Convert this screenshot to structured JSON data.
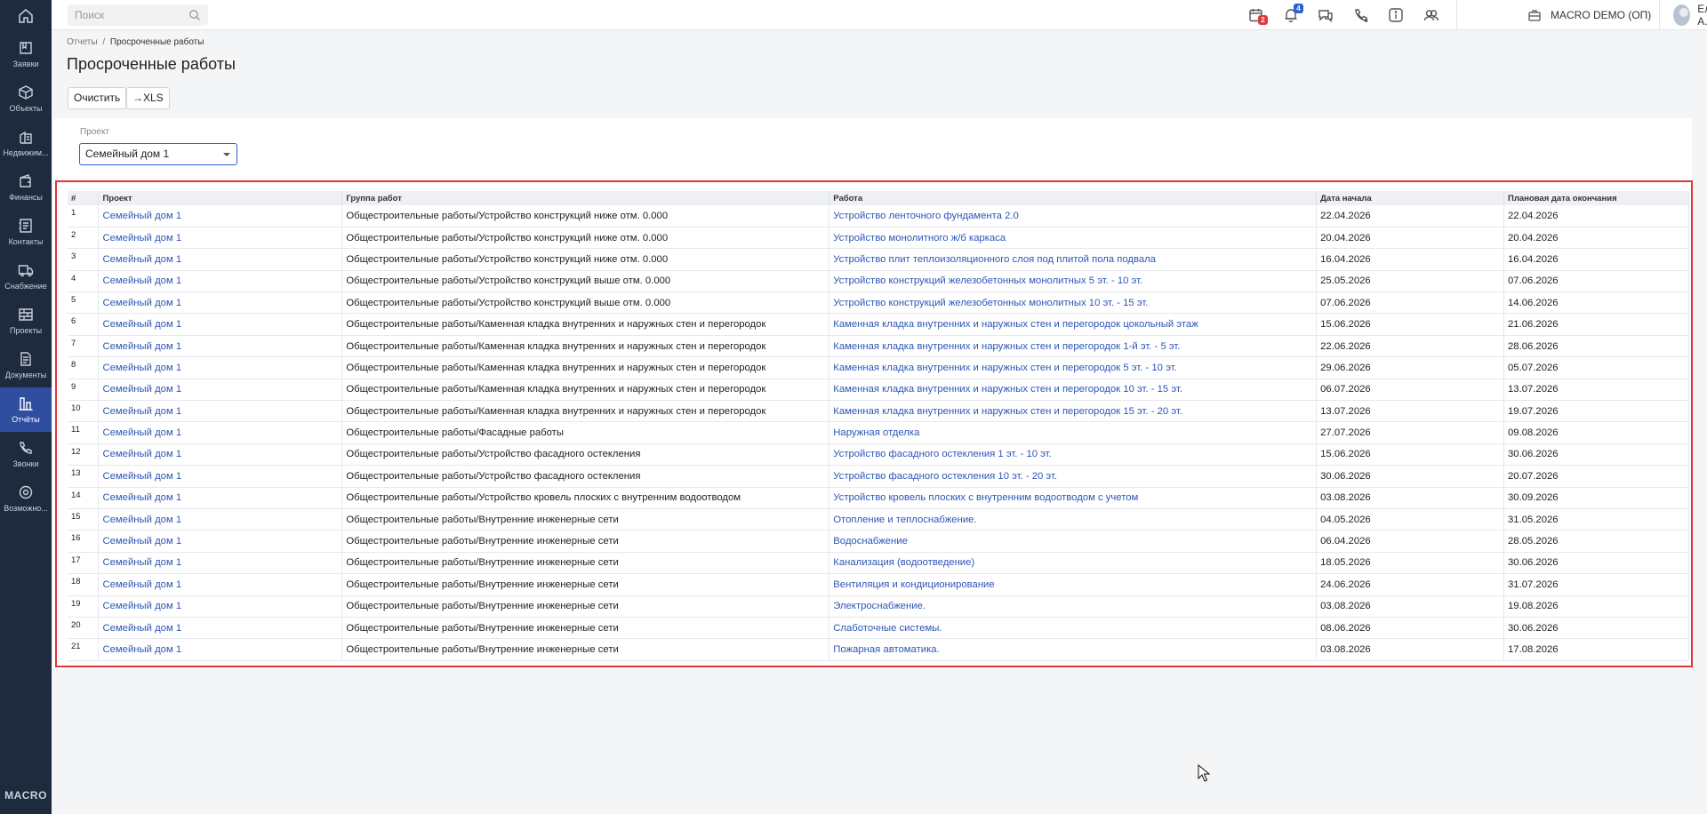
{
  "sidebar": {
    "logo": "MACRO",
    "items": [
      {
        "label": "Заявки",
        "icon": "requests-icon"
      },
      {
        "label": "Объекты",
        "icon": "box-icon"
      },
      {
        "label": "Недвижим...",
        "icon": "building-icon"
      },
      {
        "label": "Финансы",
        "icon": "wallet-icon"
      },
      {
        "label": "Контакты",
        "icon": "contacts-icon"
      },
      {
        "label": "Снабжение",
        "icon": "truck-icon"
      },
      {
        "label": "Проекты",
        "icon": "projects-icon"
      },
      {
        "label": "Документы",
        "icon": "document-icon"
      },
      {
        "label": "Отчёты",
        "icon": "reports-icon"
      },
      {
        "label": "Звонки",
        "icon": "phone-icon"
      },
      {
        "label": "Возможно...",
        "icon": "gear-icon"
      }
    ]
  },
  "topbar": {
    "search_placeholder": "Поиск",
    "calendar_badge": "2",
    "notifications_badge": "4",
    "company": "MACRO DEMO (ОП)",
    "user": "Елена А."
  },
  "breadcrumb": {
    "parent": "Отчеты",
    "separator": "/",
    "current": "Просроченные работы"
  },
  "page_title": "Просроченные работы",
  "toolbar": {
    "clear_label": "Очистить",
    "xls_label": "→XLS"
  },
  "filter": {
    "label": "Проект",
    "value": "Семейный дом 1"
  },
  "table": {
    "columns": [
      "#",
      "Проект",
      "Группа работ",
      "Работа",
      "Дата начала",
      "Плановая дата окончания"
    ],
    "rows": [
      [
        "1",
        "Семейный дом 1",
        "Общестроительные работы/Устройство конструкций ниже отм. 0.000",
        "Устройство ленточного фундамента 2.0",
        "22.04.2026",
        "22.04.2026"
      ],
      [
        "2",
        "Семейный дом 1",
        "Общестроительные работы/Устройство конструкций ниже отм. 0.000",
        "Устройство монолитного ж/б каркаса",
        "20.04.2026",
        "20.04.2026"
      ],
      [
        "3",
        "Семейный дом 1",
        "Общестроительные работы/Устройство конструкций ниже отм. 0.000",
        "Устройство плит теплоизоляционного слоя под плитой пола подвала",
        "16.04.2026",
        "16.04.2026"
      ],
      [
        "4",
        "Семейный дом 1",
        "Общестроительные работы/Устройство конструкций выше отм. 0.000",
        "Устройство конструкций железобетонных монолитных 5 эт. - 10 эт.",
        "25.05.2026",
        "07.06.2026"
      ],
      [
        "5",
        "Семейный дом 1",
        "Общестроительные работы/Устройство конструкций выше отм. 0.000",
        "Устройство конструкций железобетонных монолитных 10 эт. - 15 эт.",
        "07.06.2026",
        "14.06.2026"
      ],
      [
        "6",
        "Семейный дом 1",
        "Общестроительные работы/Каменная кладка внутренних и наружных стен и перегородок",
        "Каменная кладка внутренних и наружных стен и перегородок цокольный этаж",
        "15.06.2026",
        "21.06.2026"
      ],
      [
        "7",
        "Семейный дом 1",
        "Общестроительные работы/Каменная кладка внутренних и наружных стен и перегородок",
        "Каменная кладка внутренних и наружных стен и перегородок 1-й эт. - 5 эт.",
        "22.06.2026",
        "28.06.2026"
      ],
      [
        "8",
        "Семейный дом 1",
        "Общестроительные работы/Каменная кладка внутренних и наружных стен и перегородок",
        "Каменная кладка внутренних и наружных стен и перегородок  5 эт. - 10 эт.",
        "29.06.2026",
        "05.07.2026"
      ],
      [
        "9",
        "Семейный дом 1",
        "Общестроительные работы/Каменная кладка внутренних и наружных стен и перегородок",
        "Каменная кладка внутренних и наружных стен и перегородок  10 эт. - 15 эт.",
        "06.07.2026",
        "13.07.2026"
      ],
      [
        "10",
        "Семейный дом 1",
        "Общестроительные работы/Каменная кладка внутренних и наружных стен и перегородок",
        "Каменная кладка внутренних и наружных стен и перегородок  15 эт. - 20 эт.",
        "13.07.2026",
        "19.07.2026"
      ],
      [
        "11",
        "Семейный дом 1",
        "Общестроительные работы/Фасадные работы",
        "Наружная отделка",
        "27.07.2026",
        "09.08.2026"
      ],
      [
        "12",
        "Семейный дом 1",
        "Общестроительные работы/Устройство фасадного остекления",
        "Устройство фасадного остекления 1 эт. - 10 эт.",
        "15.06.2026",
        "30.06.2026"
      ],
      [
        "13",
        "Семейный дом 1",
        "Общестроительные работы/Устройство фасадного остекления",
        "Устройство фасадного остекления 10 эт. - 20 эт.",
        "30.06.2026",
        "20.07.2026"
      ],
      [
        "14",
        "Семейный дом 1",
        "Общестроительные работы/Устройство кровель плоских с внутренним водоотводом",
        "Устройство кровель плоских с внутренним водоотводом с учетом",
        "03.08.2026",
        "30.09.2026"
      ],
      [
        "15",
        "Семейный дом 1",
        "Общестроительные работы/Внутренние инженерные сети",
        "Отопление и теплоснабжение.",
        "04.05.2026",
        "31.05.2026"
      ],
      [
        "16",
        "Семейный дом 1",
        "Общестроительные работы/Внутренние инженерные сети",
        "Водоснабжение",
        "06.04.2026",
        "28.05.2026"
      ],
      [
        "17",
        "Семейный дом 1",
        "Общестроительные работы/Внутренние инженерные сети",
        "Канализация (водоотведение)",
        "18.05.2026",
        "30.06.2026"
      ],
      [
        "18",
        "Семейный дом 1",
        "Общестроительные работы/Внутренние инженерные сети",
        "Вентиляция и кондиционирование",
        "24.06.2026",
        "31.07.2026"
      ],
      [
        "19",
        "Семейный дом 1",
        "Общестроительные работы/Внутренние инженерные сети",
        "Электроснабжение.",
        "03.08.2026",
        "19.08.2026"
      ],
      [
        "20",
        "Семейный дом 1",
        "Общестроительные работы/Внутренние инженерные сети",
        "Слаботочные системы.",
        "08.06.2026",
        "30.06.2026"
      ],
      [
        "21",
        "Семейный дом 1",
        "Общестроительные работы/Внутренние инженерные сети",
        "Пожарная автоматика.",
        "03.08.2026",
        "17.08.2026"
      ]
    ]
  },
  "colors": {
    "sidebar": "#1e2a3d",
    "active": "#2f4ea0",
    "link": "#2d56b7",
    "highlight": "#e0373a"
  }
}
